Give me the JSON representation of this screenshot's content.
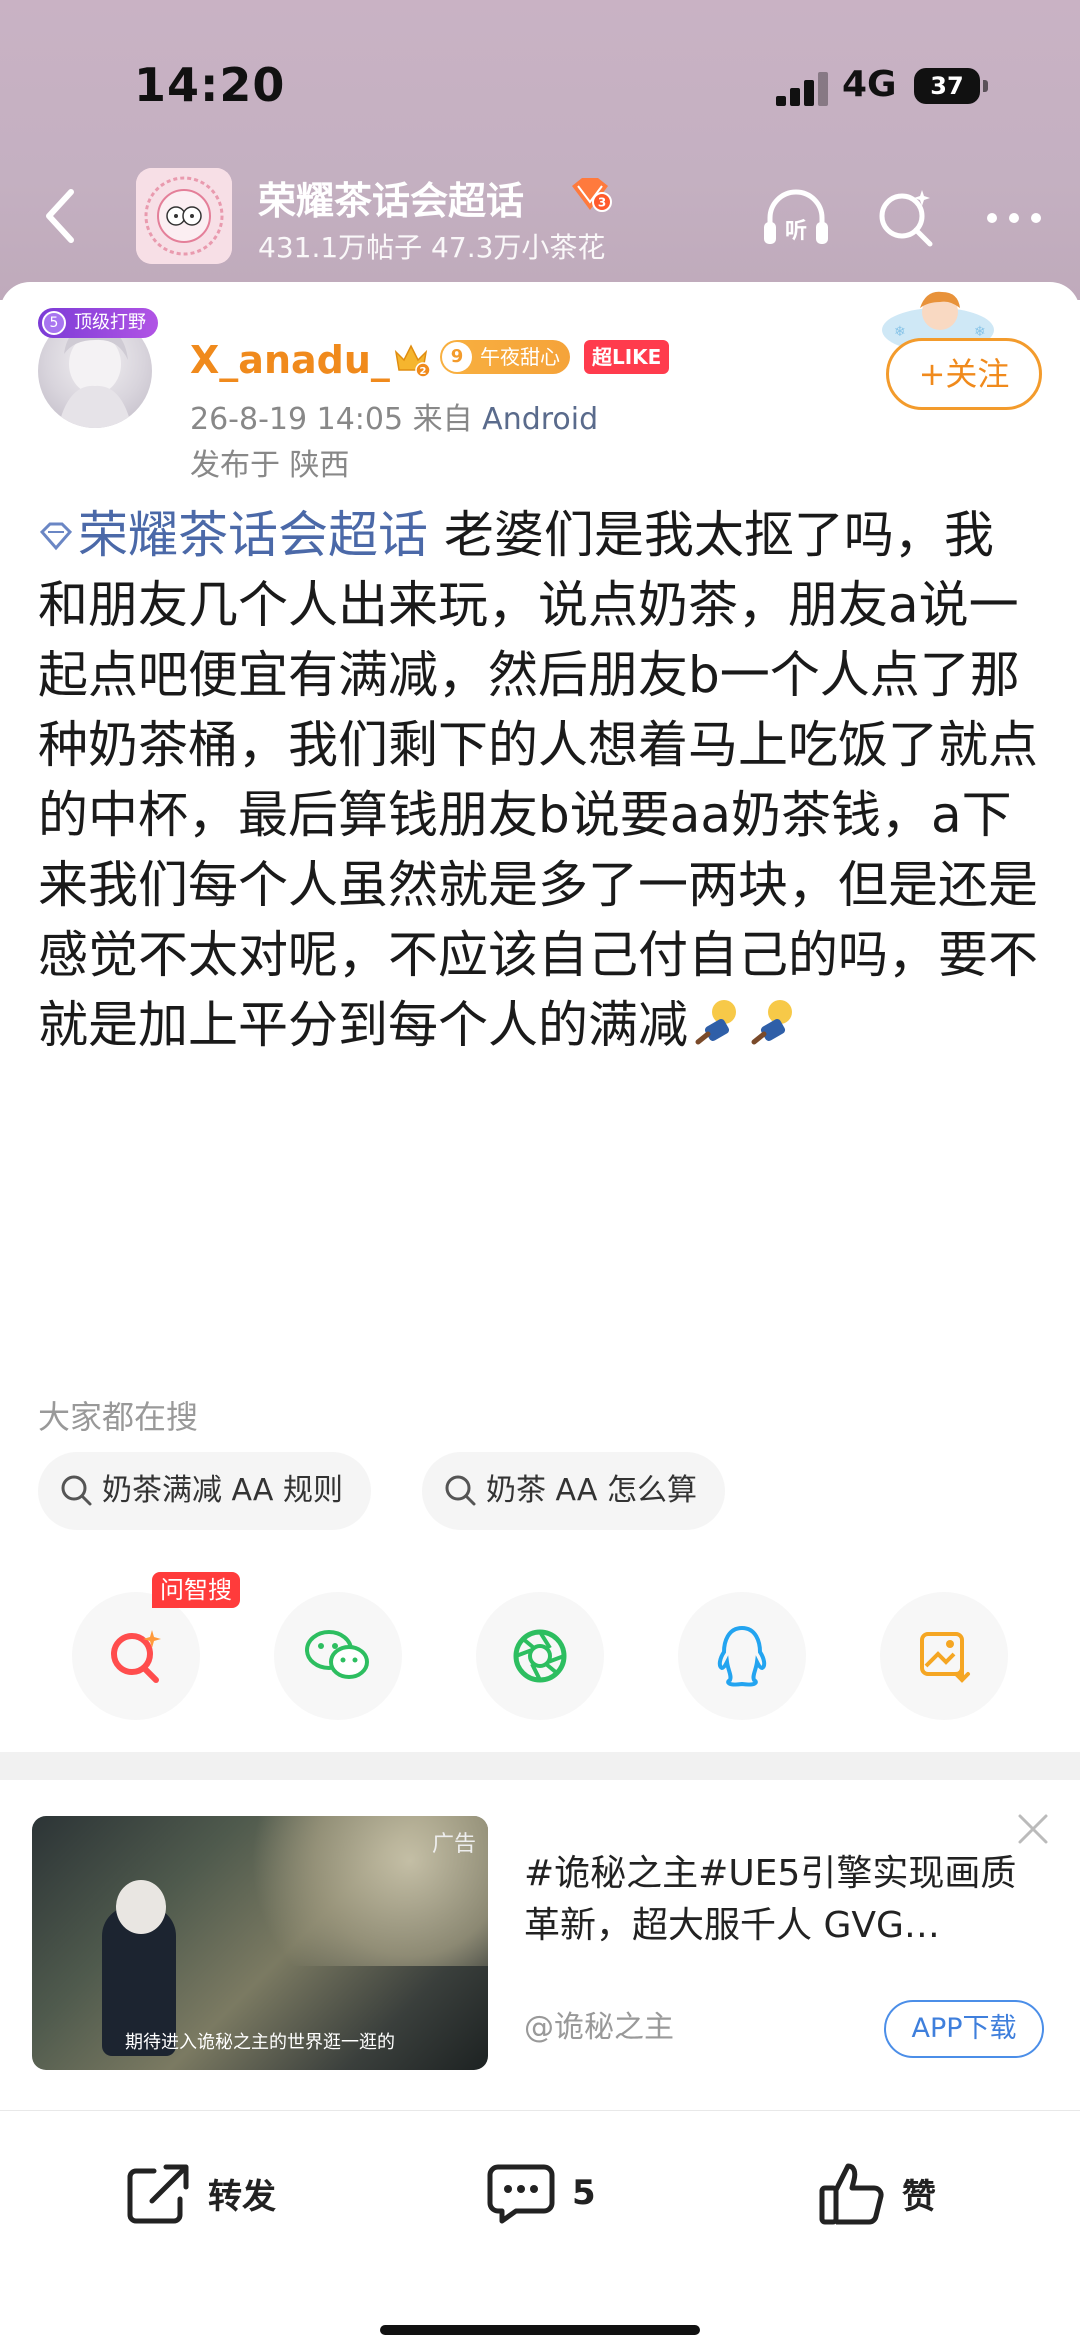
{
  "status": {
    "time": "14:20",
    "network": "4G",
    "battery": "37"
  },
  "header": {
    "group_name": "荣耀茶话会超话",
    "group_level": "3",
    "group_stats": "431.1万帖子 47.3万小茶花"
  },
  "post": {
    "vip_tag": "顶级打野",
    "vip_level": "5",
    "username": "X_anadu_",
    "crown_level": "2",
    "badge_level": "9",
    "badge_text": "午夜甜心",
    "like_badge": "超LIKE",
    "date": "26-8-19 14:05",
    "from_prefix": "来自",
    "from_device": "Android",
    "location": "发布于 陕西",
    "follow_label": "+关注",
    "topic": "荣耀茶话会超话",
    "body": " 老婆们是我太抠了吗，我和朋友几个人出来玩，说点奶茶，朋友a说一起点吧便宜有满减，然后朋友b一个人点了那种奶茶桶，我们剩下的人想着马上吃饭了就点的中杯，最后算钱朋友b说要aa奶茶钱，a下来我们每个人虽然就是多了一两块，但是还是感觉不太对呢，不应该自己付自己的吗，要不就是加上平分到每个人的满减"
  },
  "search": {
    "label": "大家都在搜",
    "chips": [
      "奶茶满减 AA 规则",
      "奶茶 AA 怎么算"
    ]
  },
  "share": {
    "wen_tag": "问智搜"
  },
  "ad": {
    "tag": "广告",
    "caption": "期待进入诡秘之主的世界逛一逛的",
    "title": "#诡秘之主#UE5引擎实现画质革新，超大服千人 GVG…",
    "source": "@诡秘之主",
    "download": "APP下载"
  },
  "bottom": {
    "repost": "转发",
    "comments": "5",
    "like": "赞"
  }
}
